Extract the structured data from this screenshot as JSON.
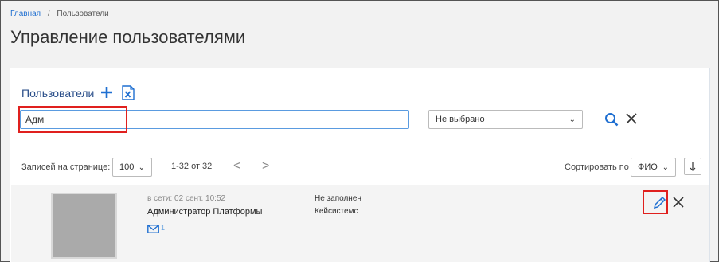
{
  "breadcrumb": {
    "home": "Главная",
    "separator": "/",
    "current": "Пользователи"
  },
  "page_title": "Управление пользователями",
  "panel": {
    "title": "Пользователи",
    "add_icon": "plus-icon",
    "export_icon": "excel-icon"
  },
  "filters": {
    "search_value": "Адм",
    "select_value": "Не выбрано",
    "search_icon": "search-icon",
    "clear_icon": "close-icon"
  },
  "pagination": {
    "per_page_label": "Записей на странице:",
    "per_page_value": "100",
    "range_text": "1-32 от 32",
    "prev": "<",
    "next": ">"
  },
  "sort": {
    "label": "Сортировать по",
    "value": "ФИО",
    "direction_icon": "arrow-down-icon"
  },
  "users": [
    {
      "status": "в сети: 02 сент. 10:52",
      "name": "Администратор Платформы",
      "info1": "Не заполнен",
      "info2": "Кейсистемс",
      "mail_count": "1"
    }
  ],
  "colors": {
    "accent": "#1f6fd1",
    "highlight": "#e0201e",
    "title": "#2b4f8a"
  }
}
